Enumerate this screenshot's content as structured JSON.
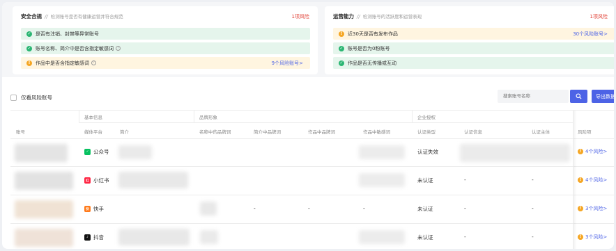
{
  "cards": {
    "compliance": {
      "title": "安全合规",
      "sep": "//",
      "desc": "检测账号是否有健康运营并符合规范",
      "risk": "1项风险",
      "rows": [
        {
          "text": "是否有注销、封禁等异常账号",
          "status": "ok"
        },
        {
          "text": "账号名称、简介中是否含指定敏感词",
          "status": "ok",
          "help": "?"
        },
        {
          "text": "作品中是否含指定敏感词",
          "status": "warn",
          "help": "?",
          "link": "9个风险账号>"
        }
      ]
    },
    "operations": {
      "title": "运营能力",
      "sep": "//",
      "desc": "检测账号的活跃度和运营表现",
      "risk": "1项风险",
      "rows": [
        {
          "text": "近30天是否有发布作品",
          "status": "warn",
          "link": "30个风险账号>"
        },
        {
          "text": "账号是否为0粉账号",
          "status": "ok"
        },
        {
          "text": "作品是否无传播或互动",
          "status": "ok"
        }
      ]
    }
  },
  "filter": {
    "label": "仅看风险账号"
  },
  "search": {
    "placeholder": "搜索账号名称"
  },
  "export": {
    "label": "导出数据"
  },
  "table": {
    "groups": {
      "basic": "基本信息",
      "brand": "品牌形象",
      "auth": "企业授权"
    },
    "headers": {
      "account": "账号",
      "platform": "媒体平台",
      "intro": "简介",
      "name_brand": "名称中的品牌词",
      "intro_brand": "简介中品牌词",
      "works_brand": "作品中品牌词",
      "works_sensitive": "作品中敏感词",
      "auth_type": "认证类型",
      "auth_info": "认证信息",
      "auth_subject": "认证主体",
      "risk": "风险项"
    },
    "rows": [
      {
        "platform": "公众号",
        "platform_color": "#07c160",
        "platform_icon": "wechat-icon",
        "name_brand": "",
        "intro_brand": "",
        "works_brand": "",
        "auth_type": "认证失效",
        "auth_info": "",
        "auth_subject": "",
        "risk": "4个风险>"
      },
      {
        "platform": "小红书",
        "platform_color": "#ff2442",
        "platform_icon": "xiaohongshu-icon",
        "name_brand": "",
        "intro_brand": "",
        "works_brand": "",
        "auth_type": "未认证",
        "auth_info": "-",
        "auth_subject": "-",
        "risk": "4个风险>"
      },
      {
        "platform": "快手",
        "platform_color": "#ff7a1a",
        "platform_icon": "kuaishou-icon",
        "name_brand": "",
        "intro_brand": "-",
        "works_brand": "-",
        "works_sensitive": "-",
        "auth_type": "未认证",
        "auth_info": "-",
        "auth_subject": "-",
        "risk": "3个风险>"
      },
      {
        "platform": "抖音",
        "platform_color": "#111111",
        "platform_icon": "douyin-icon",
        "name_brand": "",
        "intro_brand": "",
        "works_brand": "",
        "auth_type": "未认证",
        "auth_info": "-",
        "auth_subject": "-",
        "risk": "3个风险>"
      }
    ]
  },
  "colors": {
    "accent": "#4d63e6",
    "risk_red": "#e03c31",
    "ok_green": "#2bb673",
    "warn_yellow": "#f5a623"
  }
}
